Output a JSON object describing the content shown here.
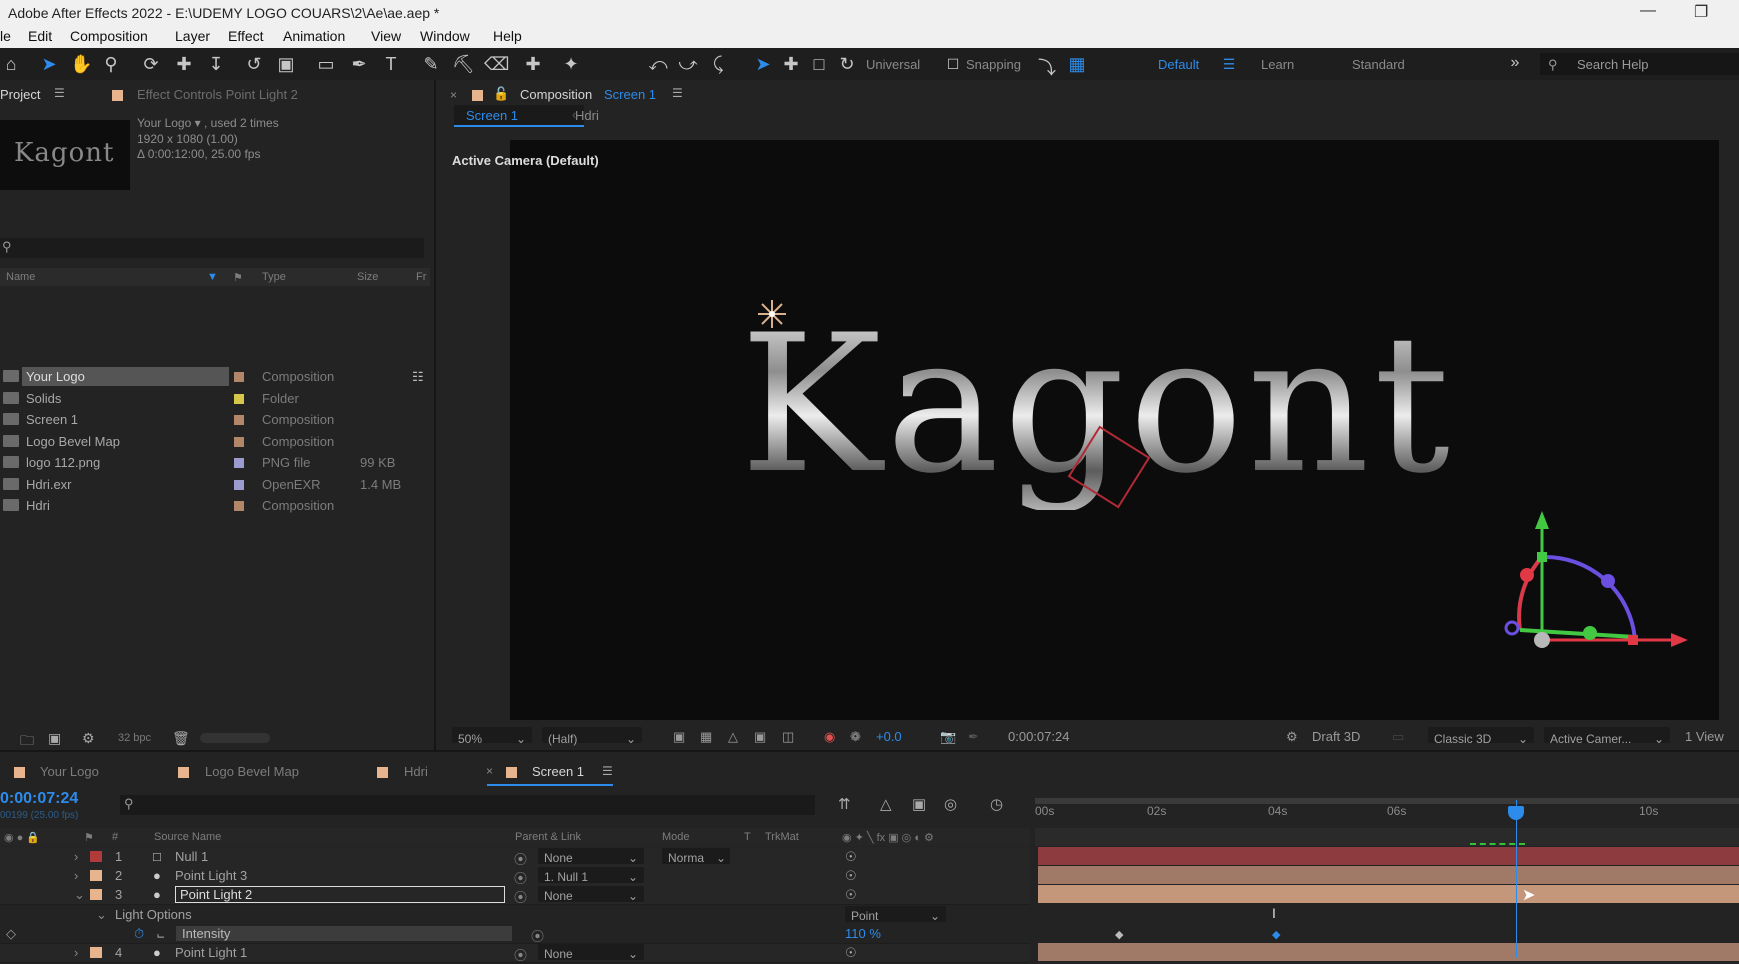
{
  "window": {
    "title": "Adobe After Effects 2022 - E:\\UDEMY LOGO COUARS\\2\\Ae\\ae.aep *"
  },
  "menu": [
    "le",
    "Edit",
    "Composition",
    "Layer",
    "Effect",
    "Animation",
    "View",
    "Window",
    "Help"
  ],
  "toolbar": {
    "universal_label": "Universal",
    "snapping_label": "Snapping",
    "workspaces": [
      "Default",
      "Learn",
      "Standard"
    ],
    "active_workspace": "Default",
    "search_placeholder": "Search Help"
  },
  "project_panel": {
    "tab_project": "Project",
    "tab_effect_controls": "Effect Controls Point Light 2",
    "selected_item_name": "Your Logo",
    "selected_item_used": ", used 2 times",
    "selected_item_res": "1920 x 1080 (1.00)",
    "selected_item_duration": "Δ 0:00:12:00, 25.00 fps",
    "thumbnail_text": "Kagont",
    "columns": {
      "name": "Name",
      "type": "Type",
      "size": "Size",
      "fr": "Fr"
    },
    "items": [
      {
        "name": "Your Logo",
        "type": "Composition",
        "size": "",
        "color": "#b3866a",
        "selected": true
      },
      {
        "name": "Solids",
        "type": "Folder",
        "size": "",
        "color": "#d6c64a",
        "selected": false
      },
      {
        "name": "Screen 1",
        "type": "Composition",
        "size": "",
        "color": "#b3866a",
        "selected": false
      },
      {
        "name": "Logo Bevel Map",
        "type": "Composition",
        "size": "",
        "color": "#b3866a",
        "selected": false
      },
      {
        "name": "logo 112.png",
        "type": "PNG file",
        "size": "99 KB",
        "color": "#9b9bd0",
        "selected": false
      },
      {
        "name": "Hdri.exr",
        "type": "OpenEXR",
        "size": "1.4 MB",
        "color": "#9b9bd0",
        "selected": false
      },
      {
        "name": "Hdri",
        "type": "Composition",
        "size": "",
        "color": "#b3866a",
        "selected": false
      }
    ],
    "bpc": "32 bpc"
  },
  "composition": {
    "tab_label": "Composition",
    "tab_comp_name": "Screen 1",
    "breadcrumbs": [
      "Screen 1",
      "Hdri"
    ],
    "camera_label": "Active Camera (Default)",
    "logo_text": "Kagont",
    "footer": {
      "zoom": "50%",
      "resolution": "(Half)",
      "exposure": "+0.0",
      "timecode": "0:00:07:24",
      "renderer_draft": "Draft 3D",
      "renderer": "Classic 3D",
      "camera": "Active Camer...",
      "views": "1 View"
    }
  },
  "timeline": {
    "tabs": [
      "Your Logo",
      "Logo Bevel Map",
      "Hdri",
      "Screen 1"
    ],
    "active_tab": "Screen 1",
    "timecode": "0:00:07:24",
    "fps": "00199 (25.00 fps)",
    "columns": {
      "source": "Source Name",
      "parent": "Parent & Link",
      "mode": "Mode",
      "t": "T",
      "trkmat": "TrkMat"
    },
    "ruler": [
      "00s",
      "02s",
      "04s",
      "06s",
      "10s"
    ],
    "layers": [
      {
        "num": "1",
        "name": "Null 1",
        "parent": "None",
        "mode": "Norma",
        "color": "#b13a3a",
        "bar": "#8e3b3f"
      },
      {
        "num": "2",
        "name": "Point Light 3",
        "parent": "1. Null 1",
        "mode": "",
        "color": "#e8b48d",
        "bar": "#a07a66"
      },
      {
        "num": "3",
        "name": "Point Light 2",
        "parent": "None",
        "mode": "",
        "color": "#e8b48d",
        "bar": "#c4977b"
      },
      {
        "num": "4",
        "name": "Point Light 1",
        "parent": "None",
        "mode": "",
        "color": "#e8b48d",
        "bar": "#a07a66"
      }
    ],
    "light_options_label": "Light Options",
    "light_type": "Point",
    "intensity_label": "Intensity",
    "intensity_value": "110 %"
  },
  "colors": {
    "accent": "#2d8ceb",
    "panel": "#232323",
    "viewer_bg": "#0c0c0c"
  }
}
